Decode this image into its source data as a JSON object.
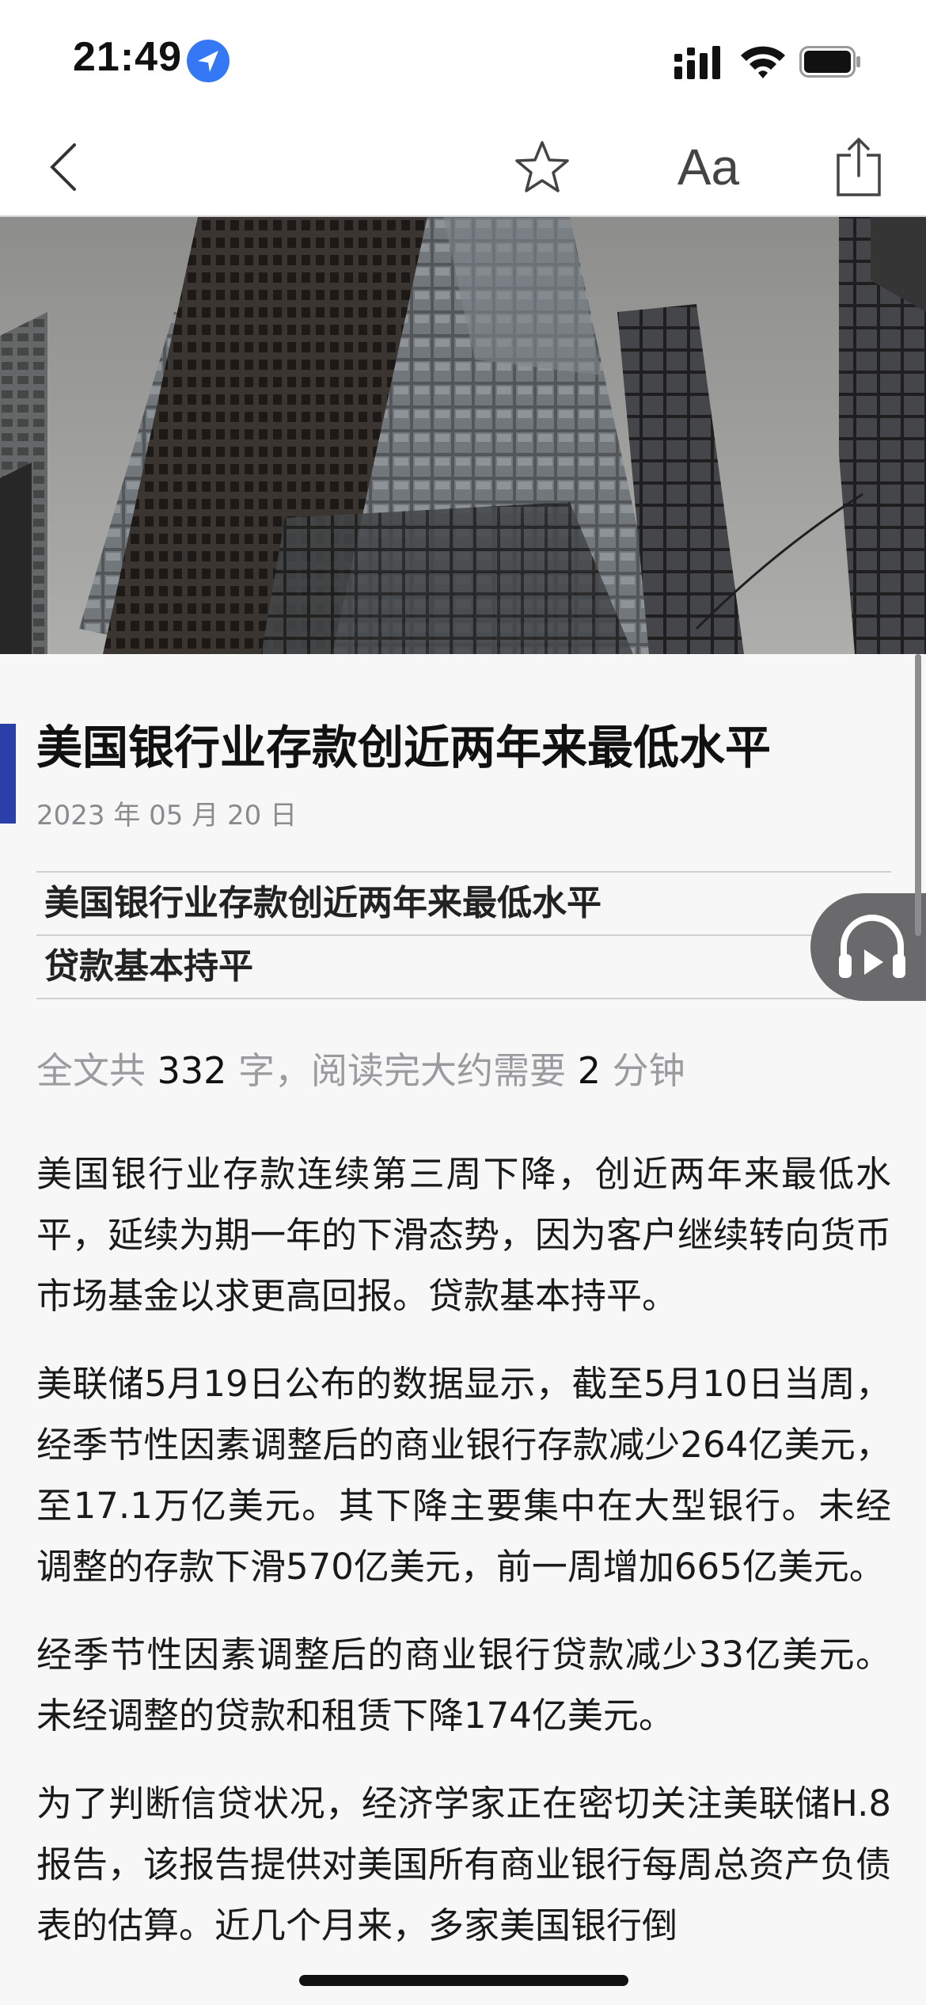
{
  "status_bar": {
    "time": "21:49",
    "icons": [
      "location-icon",
      "cellular-signal-icon",
      "wifi-icon",
      "battery-icon"
    ]
  },
  "nav": {
    "back_icon": "chevron-left-icon",
    "favorite_icon": "star-icon",
    "font_size_label": "Aa",
    "share_icon": "share-icon"
  },
  "hero": {
    "alt": "city skyscrapers photo"
  },
  "article": {
    "title": "美国银行业存款创近两年来最低水平",
    "date": "2023 年 05 月 20 日",
    "summary": [
      "美国银行业存款创近两年来最低水平",
      "贷款基本持平"
    ],
    "read_time": {
      "prefix": "全文共 ",
      "words": "332",
      "middle": " 字，阅读完大约需要 ",
      "minutes": "2",
      "suffix": " 分钟"
    },
    "paragraphs": [
      "美国银行业存款连续第三周下降，创近两年来最低水平，延续为期一年的下滑态势，因为客户继续转向货币市场基金以求更高回报。贷款基本持平。",
      "美联储5月19日公布的数据显示，截至5月10日当周，经季节性因素调整后的商业银行存款减少264亿美元，至17.1万亿美元。其下降主要集中在大型银行。未经调整的存款下滑570亿美元，前一周增加665亿美元。",
      "经季节性因素调整后的商业银行贷款减少33亿美元。未经调整的贷款和租赁下降174亿美元。",
      "为了判断信贷状况，经济学家正在密切关注美联储H.8报告，该报告提供对美国所有商业银行每周总资产负债表的估算。近几个月来，多家美国银行倒"
    ]
  },
  "colors": {
    "accent": "#2a3fa8",
    "location": "#3478f6",
    "background": "#f7f7f8"
  }
}
